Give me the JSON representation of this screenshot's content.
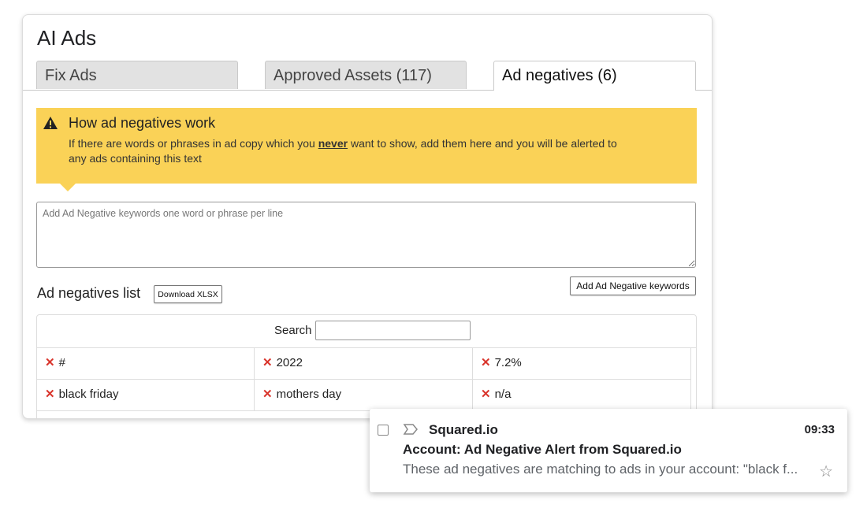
{
  "app": {
    "title": "AI Ads"
  },
  "tabs": [
    {
      "label": "Fix Ads"
    },
    {
      "label": "Approved Assets (117)"
    },
    {
      "label": "Ad negatives (6)"
    }
  ],
  "info": {
    "title": "How ad negatives work",
    "text_before": "If there are words or phrases in ad copy which you ",
    "emphasis": "never",
    "text_after": " want to show, add them here and you will be alerted to any ads containing this text"
  },
  "keywords_input": {
    "placeholder": "Add Ad Negative keywords one word or phrase per line",
    "value": ""
  },
  "actions": {
    "add_label": "Add Ad Negative keywords",
    "download_label": "Download XLSX"
  },
  "list": {
    "title": "Ad negatives list",
    "search_label": "Search",
    "search_value": "",
    "rows": [
      [
        "#",
        "2022",
        "7.2%"
      ],
      [
        "black friday",
        "mothers day",
        "n/a"
      ]
    ]
  },
  "email": {
    "sender": "Squared.io",
    "time": "09:33",
    "subject": "Account: Ad Negative Alert from Squared.io",
    "snippet": "These ad negatives are matching to ads in your account: \"black f..."
  },
  "icons": {
    "warning": "warning-icon",
    "remove": "close-icon",
    "label": "label-icon",
    "star": "star-icon",
    "remove_color": "#d9342b",
    "info_background": "#fad257"
  }
}
